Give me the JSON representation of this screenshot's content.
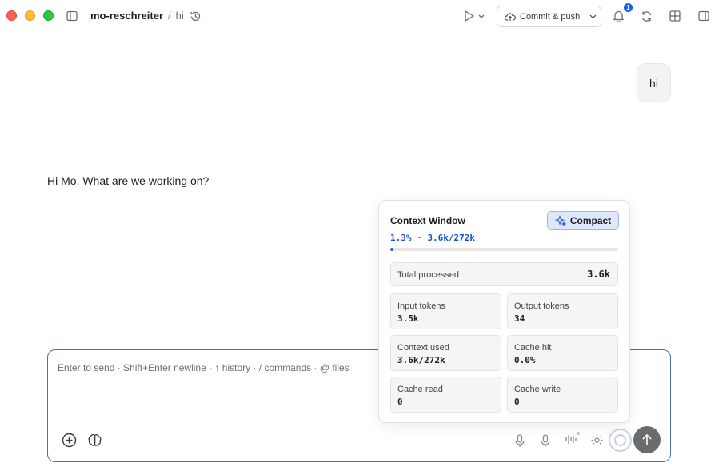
{
  "header": {
    "repo": "mo-reschreiter",
    "separator": "/",
    "branch": "hi",
    "commit_label": "Commit & push",
    "notification_count": "1"
  },
  "chat": {
    "user_message": "hi",
    "assistant_message": "Hi Mo. What are we working on?"
  },
  "composer": {
    "placeholder": "Enter to send · Shift+Enter newline · ↑ history · / commands · @ files"
  },
  "context_window": {
    "title": "Context Window",
    "compact_label": "Compact",
    "usage_text": "1.3% · 3.6k/272k",
    "usage_fraction": 0.013,
    "total_processed_label": "Total processed",
    "total_processed_value": "3.6k",
    "stats": [
      {
        "label": "Input tokens",
        "value": "3.5k"
      },
      {
        "label": "Output tokens",
        "value": "34"
      },
      {
        "label": "Context used",
        "value": "3.6k/272k"
      },
      {
        "label": "Cache hit",
        "value": "0.0%"
      },
      {
        "label": "Cache read",
        "value": "0"
      },
      {
        "label": "Cache write",
        "value": "0"
      }
    ]
  },
  "colors": {
    "accent": "#2a5cc8",
    "badge": "#1a5fe0",
    "close": "#ff5f57",
    "minimize": "#febc2e",
    "maximize": "#28c840"
  },
  "icons": {
    "sidebar_toggle": "sidebar-left-icon",
    "history": "history-icon",
    "run": "play-icon",
    "cloud_upload": "cloud-upload-icon",
    "bell": "bell-icon",
    "refresh": "refresh-icon",
    "grid": "grid-icon",
    "panel_right": "sidebar-right-icon",
    "add": "plus-circle-icon",
    "brain": "brain-icon",
    "mic": "microphone-icon",
    "waveform": "waveform-icon",
    "settings": "settings-icon",
    "send": "arrow-up-icon",
    "sparkle": "sparkle-icon"
  }
}
